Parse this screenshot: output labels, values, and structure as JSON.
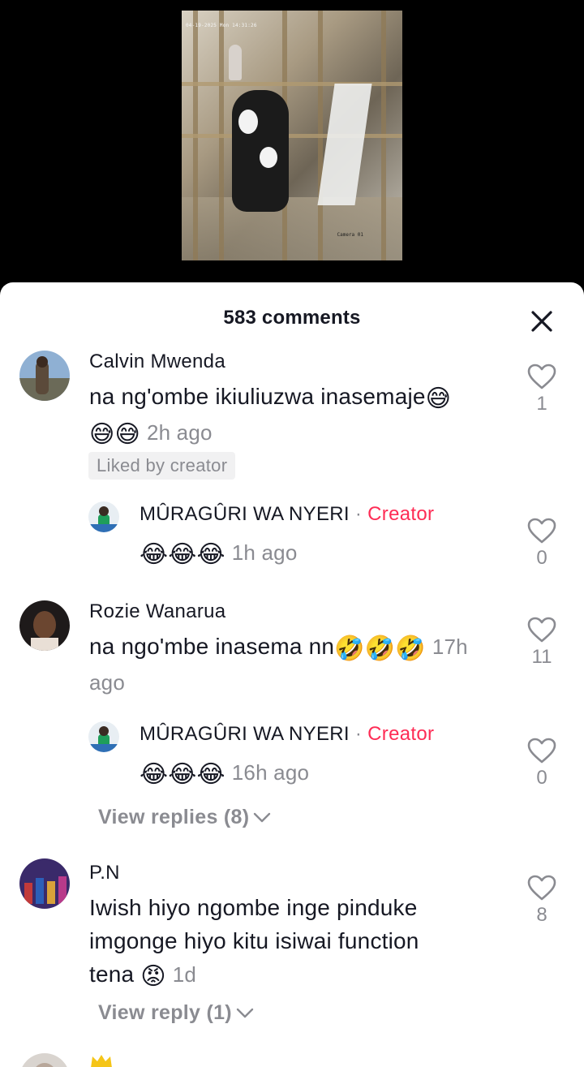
{
  "video": {
    "timestamp_overlay": "04-19-2025 Mon 14:31:26",
    "camera_label": "Camera 01"
  },
  "sheet": {
    "comments_count_label": "583 comments",
    "close_icon": "close-icon"
  },
  "comments": [
    {
      "username": "Calvin Mwenda",
      "text": "na ng'ombe ikiuliuzwa inasemaje",
      "emojis_inline": "😅",
      "emojis_line2": "😅😅",
      "time": "2h ago",
      "badge": "Liked by creator",
      "likes": "1"
    },
    {
      "username": "MÛRAGÛRI WA NYERI",
      "creator_dot": "·",
      "creator_tag": "Creator",
      "emojis": "😂😂😂",
      "time": "1h ago",
      "likes": "0"
    },
    {
      "username": "Rozie Wanarua",
      "text": "na ngo'mbe inasema nn",
      "emojis": "🤣🤣🤣",
      "time_part1": "17h",
      "time_part2": "ago",
      "likes": "11"
    },
    {
      "username": "MÛRAGÛRI WA NYERI",
      "creator_dot": "·",
      "creator_tag": "Creator",
      "emojis": "😂😂😂",
      "time": "16h ago",
      "likes": "0",
      "view_replies": "View replies (8)"
    },
    {
      "username": "P.N",
      "text_line1": "Iwish hiyo ngombe inge pinduke",
      "text_line2": "imgonge hiyo kitu isiwai function",
      "text_line3": "tena",
      "emoji": "😡",
      "time": "1d",
      "likes": "8",
      "view_replies": "View reply (1)"
    }
  ],
  "colors": {
    "creator_tag": "#fe2c55",
    "muted": "#8a8b91",
    "text": "#161823",
    "badge_bg": "#f1f1f2"
  }
}
